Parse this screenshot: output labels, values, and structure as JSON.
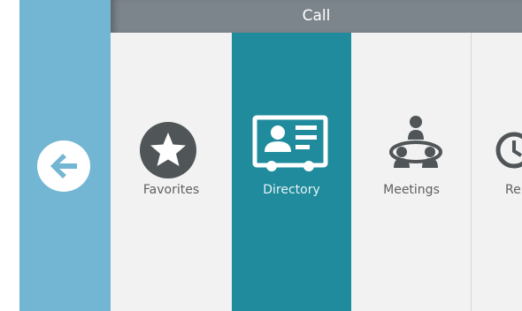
{
  "header": {
    "title": "Call"
  },
  "nav": {
    "back_icon": "arrow-left-icon"
  },
  "tiles": [
    {
      "label": "Favorites",
      "icon": "star-icon"
    },
    {
      "label": "Directory",
      "icon": "contact-card-icon",
      "selected": true
    },
    {
      "label": "Meetings",
      "icon": "meeting-table-icon"
    },
    {
      "label": "Re",
      "icon": "clock-icon"
    }
  ],
  "colors": {
    "side_panel": "#72b6d3",
    "title_bar": "#7d858c",
    "selected_tile": "#1f8b9c",
    "tile_background": "#f2f2f2",
    "icon_dark": "#505558"
  }
}
